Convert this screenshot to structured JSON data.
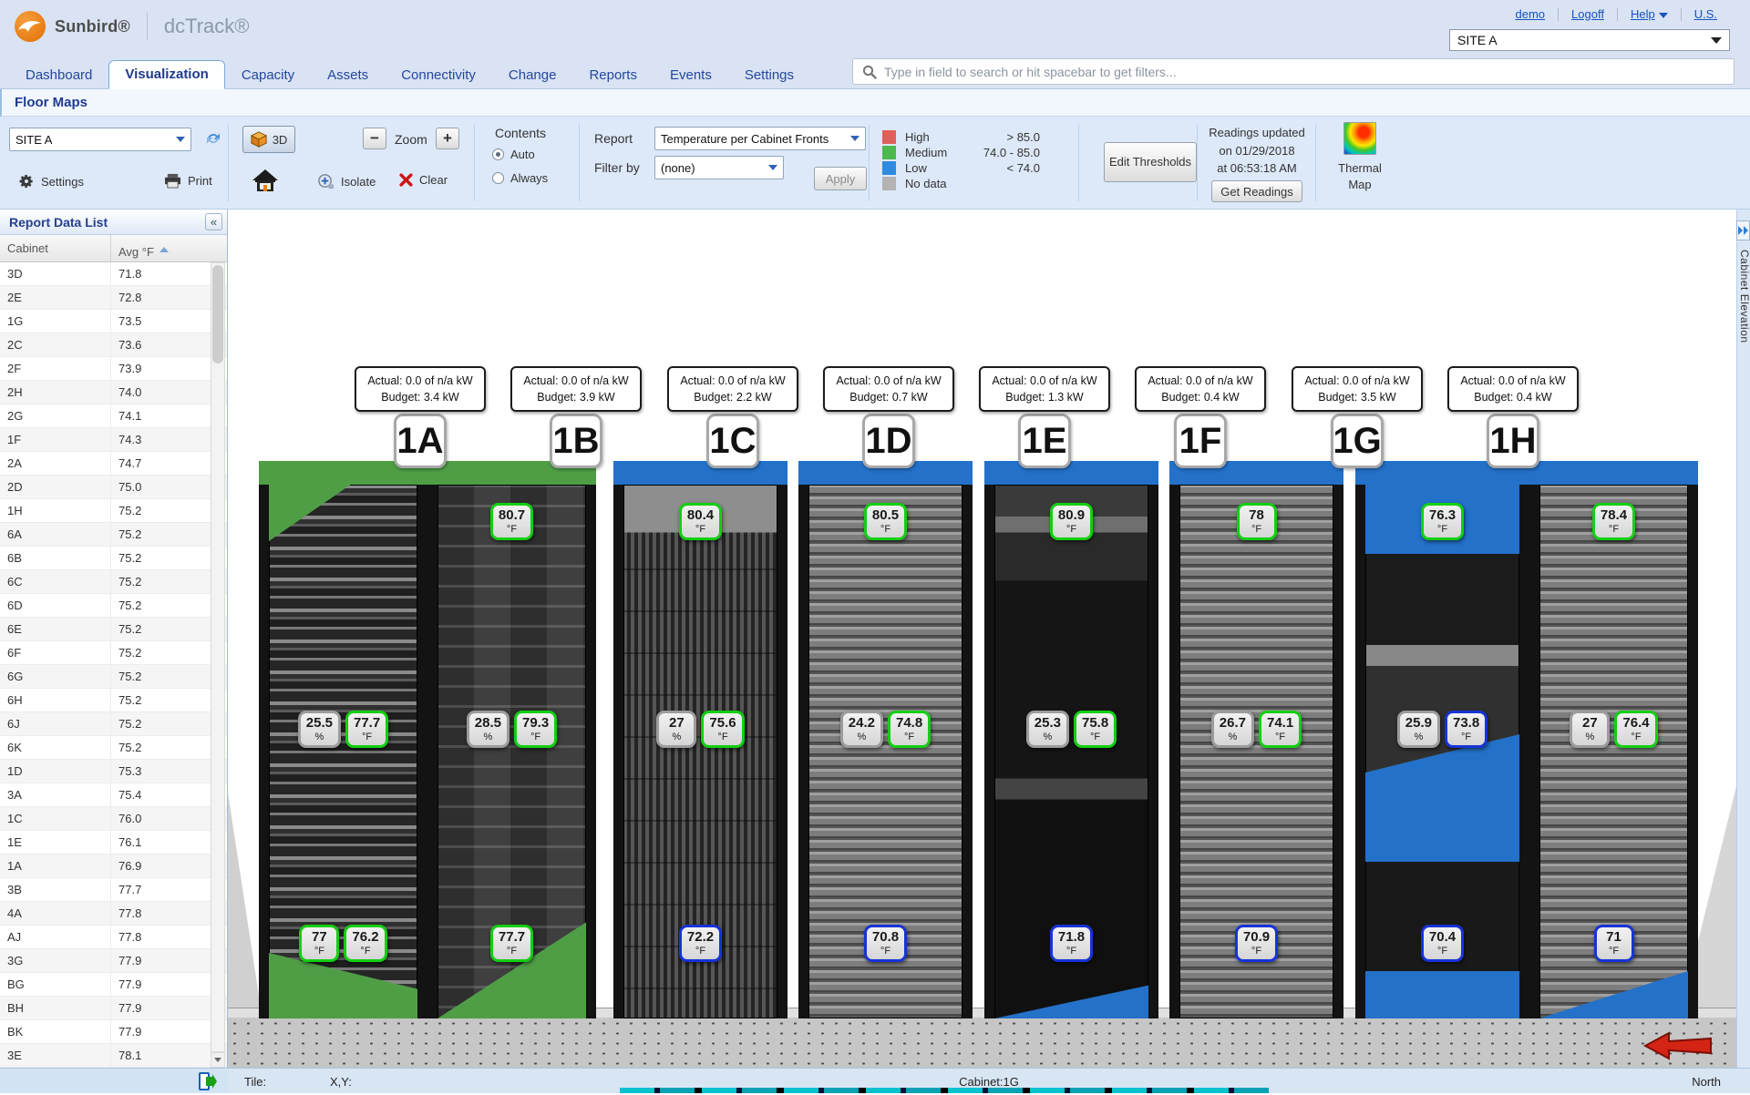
{
  "header": {
    "brand": "Sunbird®",
    "product": "dcTrack®",
    "links": [
      "demo",
      "Logoff",
      "Help",
      "U.S."
    ],
    "site_select": "SITE A",
    "search_placeholder": "Type in field to search or hit spacebar to get filters..."
  },
  "nav": {
    "tabs": [
      "Dashboard",
      "Visualization",
      "Capacity",
      "Assets",
      "Connectivity",
      "Change",
      "Reports",
      "Events",
      "Settings"
    ],
    "active": "Visualization"
  },
  "breadcrumb": "Floor Maps",
  "toolbar": {
    "site_select": "SITE A",
    "settings_label": "Settings",
    "print_label": "Print",
    "view_3d_label": "3D",
    "zoom_label": "Zoom",
    "isolate_label": "Isolate",
    "clear_label": "Clear",
    "contents": {
      "label": "Contents",
      "options": [
        "Auto",
        "Always"
      ],
      "selected": "Auto"
    },
    "report": {
      "label": "Report",
      "value": "Temperature per Cabinet Fronts"
    },
    "filter_by": {
      "label": "Filter by",
      "value": "(none)"
    },
    "apply_label": "Apply",
    "legend": [
      {
        "label": "High",
        "range": "> 85.0",
        "color": "#df605b"
      },
      {
        "label": "Medium",
        "range": "74.0 - 85.0",
        "color": "#4db84d"
      },
      {
        "label": "Low",
        "range": "< 74.0",
        "color": "#2e8be0"
      },
      {
        "label": "No data",
        "range": "",
        "color": "#b3b3b3"
      }
    ],
    "edit_thresholds_label": "Edit Thresholds",
    "readings_updated": [
      "Readings updated",
      "on 01/29/2018",
      "at 06:53:18 AM"
    ],
    "get_readings_label": "Get Readings",
    "thermal_map_label": "Thermal Map"
  },
  "report_panel": {
    "title": "Report Data List",
    "columns": [
      "Cabinet",
      "Avg °F"
    ],
    "sort": {
      "column": "Avg °F",
      "direction": "asc"
    },
    "rows": [
      [
        "3D",
        "71.8"
      ],
      [
        "2E",
        "72.8"
      ],
      [
        "1G",
        "73.5"
      ],
      [
        "2C",
        "73.6"
      ],
      [
        "2F",
        "73.9"
      ],
      [
        "2H",
        "74.0"
      ],
      [
        "2G",
        "74.1"
      ],
      [
        "1F",
        "74.3"
      ],
      [
        "2A",
        "74.7"
      ],
      [
        "2D",
        "75.0"
      ],
      [
        "1H",
        "75.2"
      ],
      [
        "6A",
        "75.2"
      ],
      [
        "6B",
        "75.2"
      ],
      [
        "6C",
        "75.2"
      ],
      [
        "6D",
        "75.2"
      ],
      [
        "6E",
        "75.2"
      ],
      [
        "6F",
        "75.2"
      ],
      [
        "6G",
        "75.2"
      ],
      [
        "6H",
        "75.2"
      ],
      [
        "6J",
        "75.2"
      ],
      [
        "6K",
        "75.2"
      ],
      [
        "1D",
        "75.3"
      ],
      [
        "3A",
        "75.4"
      ],
      [
        "1C",
        "76.0"
      ],
      [
        "1E",
        "76.1"
      ],
      [
        "1A",
        "76.9"
      ],
      [
        "3B",
        "77.7"
      ],
      [
        "4A",
        "77.8"
      ],
      [
        "AJ",
        "77.8"
      ],
      [
        "3G",
        "77.9"
      ],
      [
        "BG",
        "77.9"
      ],
      [
        "BH",
        "77.9"
      ],
      [
        "BK",
        "77.9"
      ],
      [
        "3E",
        "78.1"
      ]
    ]
  },
  "colors": {
    "badge_medium": "#12cf12",
    "badge_low": "#1733d6",
    "badge_nodata": "#9c9c9c",
    "zone_green": "#4f9e46",
    "zone_blue": "#2371c9"
  },
  "canvas": {
    "cabinets": [
      {
        "id": "1A",
        "zone": "green",
        "texture": "mixed",
        "actual": "Actual: 0.0 of n/a kW",
        "budget": "Budget: 3.4 kW",
        "top_badge": null,
        "mid_badges": [
          {
            "value": "25.5",
            "unit": "%",
            "level": "nodata"
          },
          {
            "value": "77.7",
            "unit": "°F",
            "level": "medium"
          }
        ],
        "bottom_badges": [
          {
            "value": "77",
            "unit": "°F",
            "level": "medium"
          },
          {
            "value": "76.2",
            "unit": "°F",
            "level": "medium"
          }
        ]
      },
      {
        "id": "1B",
        "zone": "green",
        "texture": "towers",
        "actual": "Actual: 0.0 of n/a kW",
        "budget": "Budget: 3.9 kW",
        "top_badge": {
          "value": "80.7",
          "unit": "°F",
          "level": "medium"
        },
        "mid_badges": [
          {
            "value": "28.5",
            "unit": "%",
            "level": "nodata"
          },
          {
            "value": "79.3",
            "unit": "°F",
            "level": "medium"
          }
        ],
        "bottom_badges": [
          {
            "value": "77.7",
            "unit": "°F",
            "level": "medium"
          }
        ]
      },
      {
        "id": "1C",
        "zone": "blue",
        "texture": "blades",
        "actual": "Actual: 0.0 of n/a kW",
        "budget": "Budget: 2.2 kW",
        "top_badge": {
          "value": "80.4",
          "unit": "°F",
          "level": "medium"
        },
        "mid_badges": [
          {
            "value": "27",
            "unit": "%",
            "level": "nodata"
          },
          {
            "value": "75.6",
            "unit": "°F",
            "level": "medium"
          }
        ],
        "bottom_badges": [
          {
            "value": "72.2",
            "unit": "°F",
            "level": "low"
          }
        ]
      },
      {
        "id": "1D",
        "zone": "blue",
        "texture": "drawers",
        "actual": "Actual: 0.0 of n/a kW",
        "budget": "Budget: 0.7 kW",
        "top_badge": {
          "value": "80.5",
          "unit": "°F",
          "level": "medium"
        },
        "mid_badges": [
          {
            "value": "24.2",
            "unit": "%",
            "level": "nodata"
          },
          {
            "value": "74.8",
            "unit": "°F",
            "level": "medium"
          }
        ],
        "bottom_badges": [
          {
            "value": "70.8",
            "unit": "°F",
            "level": "low"
          }
        ]
      },
      {
        "id": "1E",
        "zone": "blue",
        "texture": "dark",
        "actual": "Actual: 0.0 of n/a kW",
        "budget": "Budget: 1.3 kW",
        "top_badge": {
          "value": "80.9",
          "unit": "°F",
          "level": "medium"
        },
        "mid_badges": [
          {
            "value": "25.3",
            "unit": "%",
            "level": "nodata"
          },
          {
            "value": "75.8",
            "unit": "°F",
            "level": "medium"
          }
        ],
        "bottom_badges": [
          {
            "value": "71.8",
            "unit": "°F",
            "level": "low"
          }
        ]
      },
      {
        "id": "1F",
        "zone": "blue",
        "texture": "drawers",
        "actual": "Actual: 0.0 of n/a kW",
        "budget": "Budget: 0.4 kW",
        "top_badge": {
          "value": "78",
          "unit": "°F",
          "level": "medium"
        },
        "mid_badges": [
          {
            "value": "26.7",
            "unit": "%",
            "level": "nodata"
          },
          {
            "value": "74.1",
            "unit": "°F",
            "level": "medium"
          }
        ],
        "bottom_badges": [
          {
            "value": "70.9",
            "unit": "°F",
            "level": "low"
          }
        ]
      },
      {
        "id": "1G",
        "zone": "blue",
        "texture": "sparse",
        "actual": "Actual: 0.0 of n/a kW",
        "budget": "Budget: 3.5 kW",
        "top_badge": {
          "value": "76.3",
          "unit": "°F",
          "level": "medium"
        },
        "mid_badges": [
          {
            "value": "25.9",
            "unit": "%",
            "level": "nodata"
          },
          {
            "value": "73.8",
            "unit": "°F",
            "level": "low"
          }
        ],
        "bottom_badges": [
          {
            "value": "70.4",
            "unit": "°F",
            "level": "low"
          }
        ]
      },
      {
        "id": "1H",
        "zone": "blue",
        "texture": "drawers",
        "actual": "Actual: 0.0 of n/a kW",
        "budget": "Budget: 0.4 kW",
        "top_badge": {
          "value": "78.4",
          "unit": "°F",
          "level": "medium"
        },
        "mid_badges": [
          {
            "value": "27",
            "unit": "%",
            "level": "nodata"
          },
          {
            "value": "76.4",
            "unit": "°F",
            "level": "medium"
          }
        ],
        "bottom_badges": [
          {
            "value": "71",
            "unit": "°F",
            "level": "low"
          }
        ]
      }
    ]
  },
  "status_bar": {
    "tile_label": "Tile:",
    "xy_label": "X,Y:",
    "cabinet_label": "Cabinet:1G",
    "north_label": "North"
  },
  "right_tab": {
    "label": "Cabinet Elevation"
  }
}
